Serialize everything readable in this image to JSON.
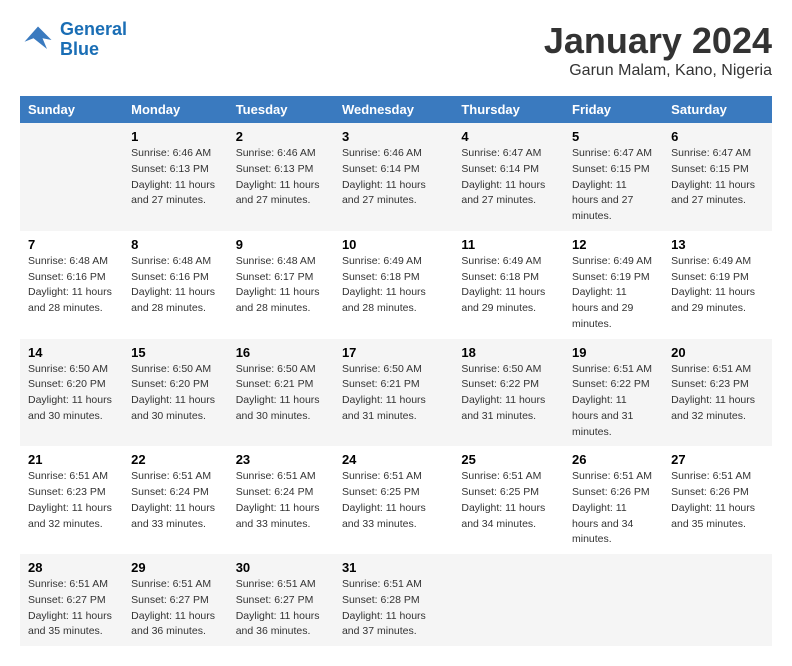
{
  "header": {
    "logo_line1": "General",
    "logo_line2": "Blue",
    "month_title": "January 2024",
    "location": "Garun Malam, Kano, Nigeria"
  },
  "weekdays": [
    "Sunday",
    "Monday",
    "Tuesday",
    "Wednesday",
    "Thursday",
    "Friday",
    "Saturday"
  ],
  "weeks": [
    [
      {
        "day": "",
        "sunrise": "",
        "sunset": "",
        "daylight": ""
      },
      {
        "day": "1",
        "sunrise": "Sunrise: 6:46 AM",
        "sunset": "Sunset: 6:13 PM",
        "daylight": "Daylight: 11 hours and 27 minutes."
      },
      {
        "day": "2",
        "sunrise": "Sunrise: 6:46 AM",
        "sunset": "Sunset: 6:13 PM",
        "daylight": "Daylight: 11 hours and 27 minutes."
      },
      {
        "day": "3",
        "sunrise": "Sunrise: 6:46 AM",
        "sunset": "Sunset: 6:14 PM",
        "daylight": "Daylight: 11 hours and 27 minutes."
      },
      {
        "day": "4",
        "sunrise": "Sunrise: 6:47 AM",
        "sunset": "Sunset: 6:14 PM",
        "daylight": "Daylight: 11 hours and 27 minutes."
      },
      {
        "day": "5",
        "sunrise": "Sunrise: 6:47 AM",
        "sunset": "Sunset: 6:15 PM",
        "daylight": "Daylight: 11 hours and 27 minutes."
      },
      {
        "day": "6",
        "sunrise": "Sunrise: 6:47 AM",
        "sunset": "Sunset: 6:15 PM",
        "daylight": "Daylight: 11 hours and 27 minutes."
      }
    ],
    [
      {
        "day": "7",
        "sunrise": "Sunrise: 6:48 AM",
        "sunset": "Sunset: 6:16 PM",
        "daylight": "Daylight: 11 hours and 28 minutes."
      },
      {
        "day": "8",
        "sunrise": "Sunrise: 6:48 AM",
        "sunset": "Sunset: 6:16 PM",
        "daylight": "Daylight: 11 hours and 28 minutes."
      },
      {
        "day": "9",
        "sunrise": "Sunrise: 6:48 AM",
        "sunset": "Sunset: 6:17 PM",
        "daylight": "Daylight: 11 hours and 28 minutes."
      },
      {
        "day": "10",
        "sunrise": "Sunrise: 6:49 AM",
        "sunset": "Sunset: 6:18 PM",
        "daylight": "Daylight: 11 hours and 28 minutes."
      },
      {
        "day": "11",
        "sunrise": "Sunrise: 6:49 AM",
        "sunset": "Sunset: 6:18 PM",
        "daylight": "Daylight: 11 hours and 29 minutes."
      },
      {
        "day": "12",
        "sunrise": "Sunrise: 6:49 AM",
        "sunset": "Sunset: 6:19 PM",
        "daylight": "Daylight: 11 hours and 29 minutes."
      },
      {
        "day": "13",
        "sunrise": "Sunrise: 6:49 AM",
        "sunset": "Sunset: 6:19 PM",
        "daylight": "Daylight: 11 hours and 29 minutes."
      }
    ],
    [
      {
        "day": "14",
        "sunrise": "Sunrise: 6:50 AM",
        "sunset": "Sunset: 6:20 PM",
        "daylight": "Daylight: 11 hours and 30 minutes."
      },
      {
        "day": "15",
        "sunrise": "Sunrise: 6:50 AM",
        "sunset": "Sunset: 6:20 PM",
        "daylight": "Daylight: 11 hours and 30 minutes."
      },
      {
        "day": "16",
        "sunrise": "Sunrise: 6:50 AM",
        "sunset": "Sunset: 6:21 PM",
        "daylight": "Daylight: 11 hours and 30 minutes."
      },
      {
        "day": "17",
        "sunrise": "Sunrise: 6:50 AM",
        "sunset": "Sunset: 6:21 PM",
        "daylight": "Daylight: 11 hours and 31 minutes."
      },
      {
        "day": "18",
        "sunrise": "Sunrise: 6:50 AM",
        "sunset": "Sunset: 6:22 PM",
        "daylight": "Daylight: 11 hours and 31 minutes."
      },
      {
        "day": "19",
        "sunrise": "Sunrise: 6:51 AM",
        "sunset": "Sunset: 6:22 PM",
        "daylight": "Daylight: 11 hours and 31 minutes."
      },
      {
        "day": "20",
        "sunrise": "Sunrise: 6:51 AM",
        "sunset": "Sunset: 6:23 PM",
        "daylight": "Daylight: 11 hours and 32 minutes."
      }
    ],
    [
      {
        "day": "21",
        "sunrise": "Sunrise: 6:51 AM",
        "sunset": "Sunset: 6:23 PM",
        "daylight": "Daylight: 11 hours and 32 minutes."
      },
      {
        "day": "22",
        "sunrise": "Sunrise: 6:51 AM",
        "sunset": "Sunset: 6:24 PM",
        "daylight": "Daylight: 11 hours and 33 minutes."
      },
      {
        "day": "23",
        "sunrise": "Sunrise: 6:51 AM",
        "sunset": "Sunset: 6:24 PM",
        "daylight": "Daylight: 11 hours and 33 minutes."
      },
      {
        "day": "24",
        "sunrise": "Sunrise: 6:51 AM",
        "sunset": "Sunset: 6:25 PM",
        "daylight": "Daylight: 11 hours and 33 minutes."
      },
      {
        "day": "25",
        "sunrise": "Sunrise: 6:51 AM",
        "sunset": "Sunset: 6:25 PM",
        "daylight": "Daylight: 11 hours and 34 minutes."
      },
      {
        "day": "26",
        "sunrise": "Sunrise: 6:51 AM",
        "sunset": "Sunset: 6:26 PM",
        "daylight": "Daylight: 11 hours and 34 minutes."
      },
      {
        "day": "27",
        "sunrise": "Sunrise: 6:51 AM",
        "sunset": "Sunset: 6:26 PM",
        "daylight": "Daylight: 11 hours and 35 minutes."
      }
    ],
    [
      {
        "day": "28",
        "sunrise": "Sunrise: 6:51 AM",
        "sunset": "Sunset: 6:27 PM",
        "daylight": "Daylight: 11 hours and 35 minutes."
      },
      {
        "day": "29",
        "sunrise": "Sunrise: 6:51 AM",
        "sunset": "Sunset: 6:27 PM",
        "daylight": "Daylight: 11 hours and 36 minutes."
      },
      {
        "day": "30",
        "sunrise": "Sunrise: 6:51 AM",
        "sunset": "Sunset: 6:27 PM",
        "daylight": "Daylight: 11 hours and 36 minutes."
      },
      {
        "day": "31",
        "sunrise": "Sunrise: 6:51 AM",
        "sunset": "Sunset: 6:28 PM",
        "daylight": "Daylight: 11 hours and 37 minutes."
      },
      {
        "day": "",
        "sunrise": "",
        "sunset": "",
        "daylight": ""
      },
      {
        "day": "",
        "sunrise": "",
        "sunset": "",
        "daylight": ""
      },
      {
        "day": "",
        "sunrise": "",
        "sunset": "",
        "daylight": ""
      }
    ]
  ]
}
